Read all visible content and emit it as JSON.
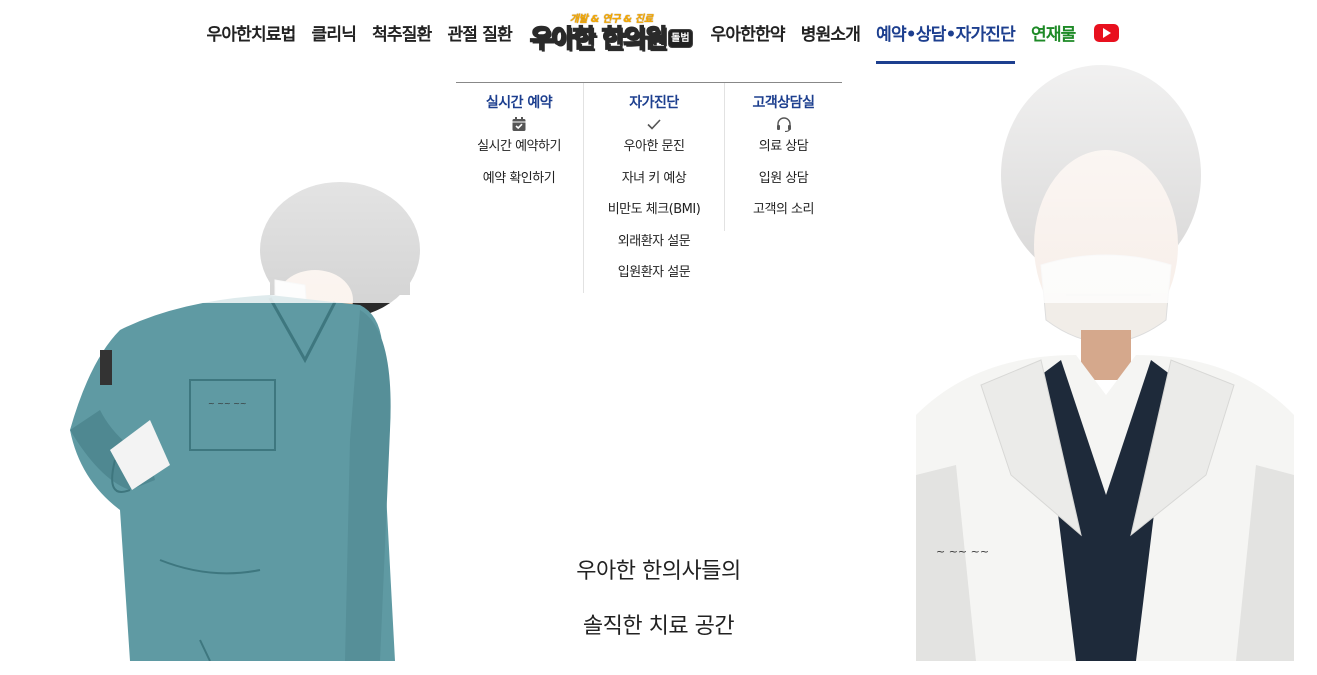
{
  "nav": {
    "left_items": [
      {
        "label": "우아한치료법"
      },
      {
        "label": "클리닉"
      },
      {
        "label": "척추질환"
      },
      {
        "label": "관절 질환"
      }
    ],
    "logo": {
      "tagline": "개발 & 연구 & 진료",
      "name": "우아한 한의원",
      "badge": "돌범"
    },
    "right_items": [
      {
        "label": "우아한한약"
      },
      {
        "label": "병원소개"
      },
      {
        "label": "예약•상담•자가진단",
        "active": true
      },
      {
        "label": "연재물",
        "accent": "#1e8a27"
      }
    ],
    "youtube_icon": "youtube-icon",
    "active_color": "#1d3f8f"
  },
  "dropdown": {
    "columns": [
      {
        "title": "실시간 예약",
        "icon": "calendar-check-icon",
        "links": [
          "실시간 예약하기",
          "예약 확인하기"
        ]
      },
      {
        "title": "자가진단",
        "icon": "checkmark-icon",
        "links": [
          "우아한 문진",
          "자녀 키 예상",
          "비만도 체크(BMI)",
          "외래환자 설문",
          "입원환자 설문"
        ]
      },
      {
        "title": "고객상담실",
        "icon": "headset-icon",
        "links": [
          "의료 상담",
          "입원 상담",
          "고객의 소리"
        ]
      }
    ]
  },
  "hero": {
    "line1": "우아한 한의사들의",
    "line2": "솔직한 치료 공간"
  }
}
